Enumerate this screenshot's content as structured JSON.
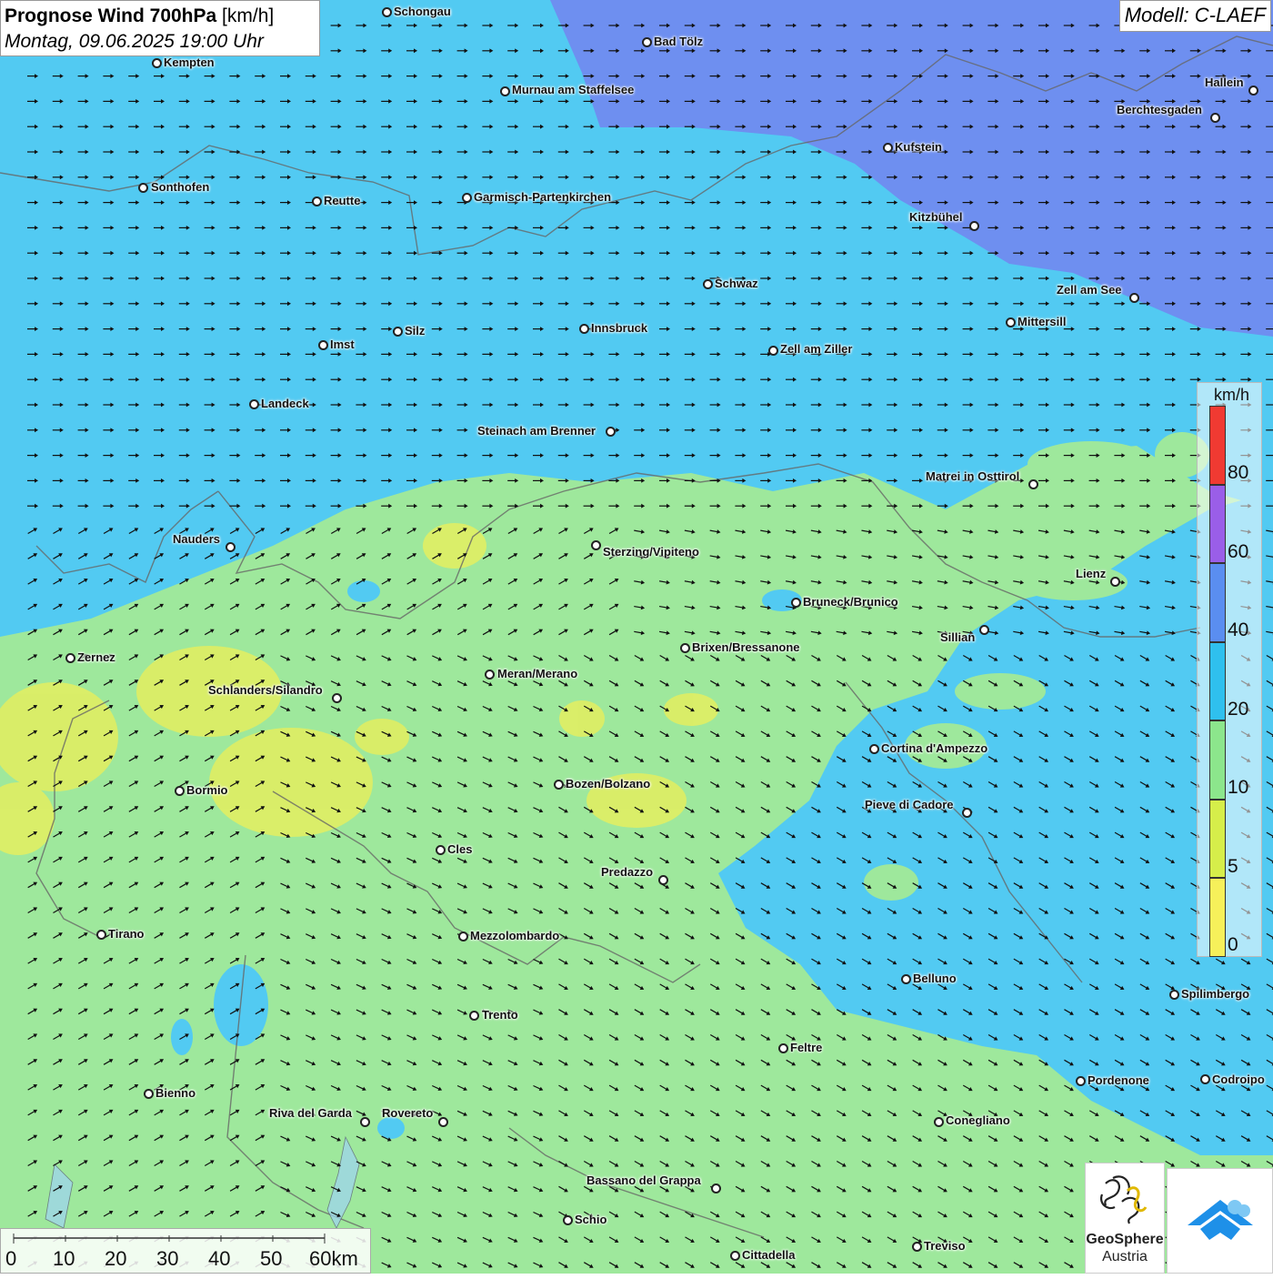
{
  "title": {
    "main": "Prognose Wind 700hPa",
    "unit": "[km/h]",
    "datetime": "Montag, 09.06.2025 19:00 Uhr"
  },
  "model": "Modell: C-LAEF",
  "cities": [
    {
      "name": "Schongau"
    },
    {
      "name": "Bad Tölz"
    },
    {
      "name": "Kempten"
    },
    {
      "name": "Murnau am Staffelsee"
    },
    {
      "name": "Hallein"
    },
    {
      "name": "Berchtesgaden"
    },
    {
      "name": "Kufstein"
    },
    {
      "name": "Sonthofen"
    },
    {
      "name": "Reutte"
    },
    {
      "name": "Garmisch-Partenkirchen"
    },
    {
      "name": "Kitzbühel"
    },
    {
      "name": "Schwaz"
    },
    {
      "name": "Zell am See"
    },
    {
      "name": "Mittersill"
    },
    {
      "name": "Innsbruck"
    },
    {
      "name": "Silz"
    },
    {
      "name": "Imst"
    },
    {
      "name": "Zell am Ziller"
    },
    {
      "name": "Landeck"
    },
    {
      "name": "Steinach am Brenner"
    },
    {
      "name": "Matrei in Osttirol"
    },
    {
      "name": "Nauders"
    },
    {
      "name": "Sterzing/Vipiteno"
    },
    {
      "name": "Lienz"
    },
    {
      "name": "Bruneck/Brunico"
    },
    {
      "name": "Sillian"
    },
    {
      "name": "Zernez"
    },
    {
      "name": "Brixen/Bressanone"
    },
    {
      "name": "Meran/Merano"
    },
    {
      "name": "Schlanders/Silandro"
    },
    {
      "name": "Cortina d'Ampezzo"
    },
    {
      "name": "Bozen/Bolzano"
    },
    {
      "name": "Bormio"
    },
    {
      "name": "Pieve di Cadore"
    },
    {
      "name": "Cles"
    },
    {
      "name": "Predazzo"
    },
    {
      "name": "Tirano"
    },
    {
      "name": "Mezzolombardo"
    },
    {
      "name": "Belluno"
    },
    {
      "name": "Spilimbergo"
    },
    {
      "name": "Trento"
    },
    {
      "name": "Feltre"
    },
    {
      "name": "Bienno"
    },
    {
      "name": "Pordenone"
    },
    {
      "name": "Codroipo"
    },
    {
      "name": "Riva del Garda"
    },
    {
      "name": "Rovereto"
    },
    {
      "name": "Conegliano"
    },
    {
      "name": "Bassano del Grappa"
    },
    {
      "name": "Schio"
    },
    {
      "name": "Treviso"
    },
    {
      "name": "Cittadella"
    }
  ],
  "legend": {
    "unit": "km/h",
    "classes": [
      {
        "label": "80",
        "color": "#f03a32"
      },
      {
        "label": "60",
        "color": "#9a5ee8"
      },
      {
        "label": "40",
        "color": "#5a8ef0"
      },
      {
        "label": "20",
        "color": "#2fc0ee"
      },
      {
        "label": "10",
        "color": "#8ce68c"
      },
      {
        "label": "5",
        "color": "#d6ee4a"
      },
      {
        "label": "0",
        "color": "#f6f05a"
      }
    ]
  },
  "scalebar": {
    "labels": [
      "0",
      "10",
      "20",
      "30",
      "40",
      "50",
      "60km"
    ]
  },
  "logo": {
    "line1": "GeoSphere",
    "line2": "Austria"
  },
  "colors": {
    "zone_blue": "#6e8ff0",
    "zone_cyan": "#52caf2",
    "zone_green": "#9ee89c",
    "zone_yellow": "#e4ee60"
  }
}
